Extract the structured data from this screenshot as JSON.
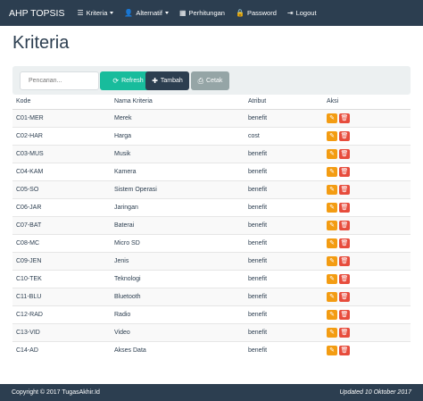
{
  "navbar": {
    "brand": "AHP TOPSIS",
    "items": [
      {
        "label": "Kriteria",
        "icon": "list-icon",
        "dropdown": true
      },
      {
        "label": "Alternatif",
        "icon": "user-icon",
        "dropdown": true
      },
      {
        "label": "Perhitungan",
        "icon": "table-icon",
        "dropdown": false
      },
      {
        "label": "Password",
        "icon": "lock-icon",
        "dropdown": false
      },
      {
        "label": "Logout",
        "icon": "logout-icon",
        "dropdown": false
      }
    ]
  },
  "page": {
    "title": "Kriteria"
  },
  "toolbar": {
    "search_placeholder": "Pencarian...",
    "refresh_label": "Refresh",
    "add_label": "Tambah",
    "print_label": "Cetak"
  },
  "table": {
    "headers": [
      "Kode",
      "Nama Kriteria",
      "Atribut",
      "Aksi"
    ],
    "rows": [
      {
        "kode": "C01-MER",
        "nama": "Merek",
        "atribut": "benefit"
      },
      {
        "kode": "C02-HAR",
        "nama": "Harga",
        "atribut": "cost"
      },
      {
        "kode": "C03-MUS",
        "nama": "Musik",
        "atribut": "benefit"
      },
      {
        "kode": "C04-KAM",
        "nama": "Kamera",
        "atribut": "benefit"
      },
      {
        "kode": "C05-SO",
        "nama": "Sistem Operasi",
        "atribut": "benefit"
      },
      {
        "kode": "C06-JAR",
        "nama": "Jaringan",
        "atribut": "benefit"
      },
      {
        "kode": "C07-BAT",
        "nama": "Baterai",
        "atribut": "benefit"
      },
      {
        "kode": "C08-MC",
        "nama": "Micro SD",
        "atribut": "benefit"
      },
      {
        "kode": "C09-JEN",
        "nama": "Jenis",
        "atribut": "benefit"
      },
      {
        "kode": "C10-TEK",
        "nama": "Teknologi",
        "atribut": "benefit"
      },
      {
        "kode": "C11-BLU",
        "nama": "Bluetooth",
        "atribut": "benefit"
      },
      {
        "kode": "C12-RAD",
        "nama": "Radio",
        "atribut": "benefit"
      },
      {
        "kode": "C13-VID",
        "nama": "Video",
        "atribut": "benefit"
      },
      {
        "kode": "C14-AD",
        "nama": "Akses Data",
        "atribut": "benefit"
      }
    ]
  },
  "footer": {
    "copyright": "Copyright © 2017 TugasAkhir.Id",
    "updated": "Updated 10 Oktober 2017"
  },
  "colors": {
    "navbar": "#2c3e50",
    "refresh": "#18bc9c",
    "add": "#2c3e50",
    "print": "#95a5a6",
    "edit": "#f39c12",
    "delete": "#e74c3c"
  }
}
